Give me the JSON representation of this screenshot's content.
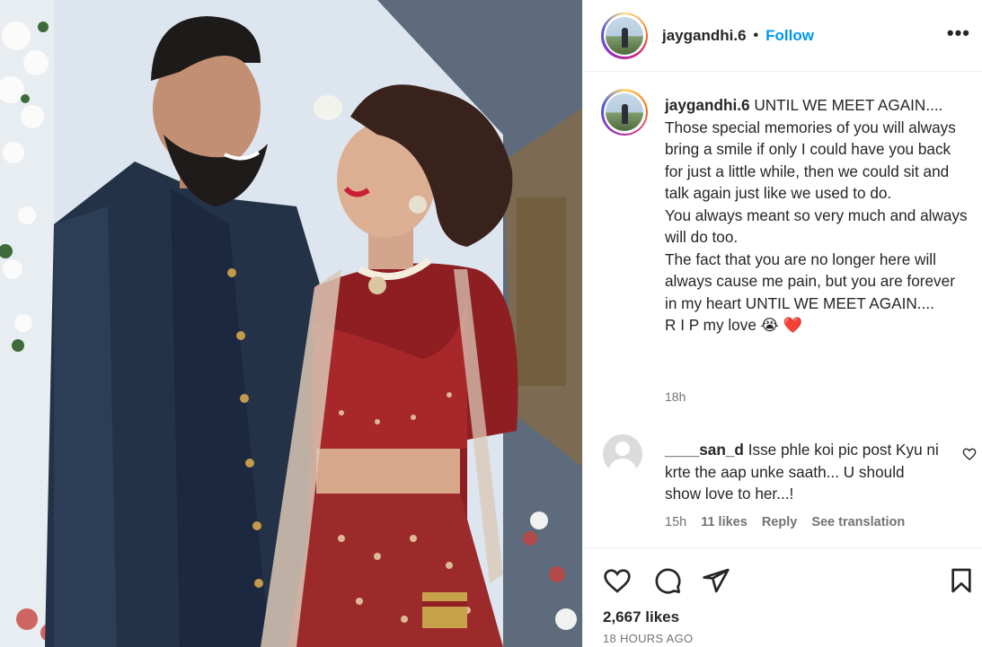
{
  "post": {
    "username": "jaygandhi.6",
    "separator": "•",
    "follow_label": "Follow",
    "more_label": "•••",
    "caption": "UNTIL WE MEET AGAIN....\nThose special memories of you will always bring a smile if only I could have you back for just a little while, then we could sit and talk again just like we used to do.\nYou always meant so very much and always will do too.\nThe fact that you are no longer here will always cause me pain, but you are forever in my heart UNTIL WE MEET AGAIN....\nR I P my love 😭 ❤️",
    "caption_time": "18h"
  },
  "comment": {
    "username": "____san_d",
    "text": "Isse phle koi pic post Kyu ni krte the aap unke saath... U should show love to her...!",
    "time": "15h",
    "likes": "11 likes",
    "reply_label": "Reply",
    "translate_label": "See translation"
  },
  "footer": {
    "likes": "2,667 likes",
    "time_ago": "18 HOURS AGO"
  },
  "icons": {
    "like": "heart-icon",
    "comment": "comment-bubble-icon",
    "share": "paper-plane-icon",
    "save": "bookmark-icon",
    "more": "more-options-icon",
    "comment_like": "small-heart-icon"
  },
  "colors": {
    "link_blue": "#0095f6",
    "text": "#262626",
    "muted": "#737373"
  }
}
